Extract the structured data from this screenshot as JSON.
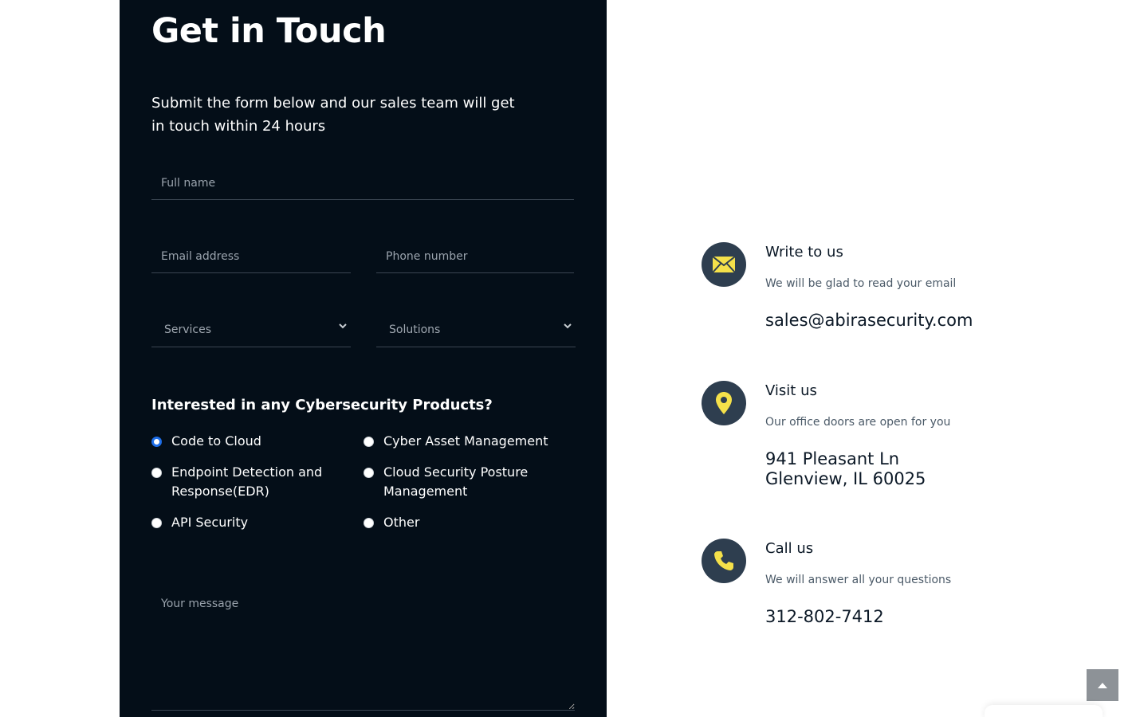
{
  "form": {
    "title": "Get in Touch",
    "subtitle": "Submit the form below and our sales team will get in touch within 24 hours",
    "full_name_placeholder": "Full name",
    "email_placeholder": "Email address",
    "phone_placeholder": "Phone number",
    "services_select": "Services",
    "solutions_select": "Solutions",
    "products_heading": "Interested in any Cybersecurity Products?",
    "products": [
      {
        "label": "Code to Cloud",
        "checked": true
      },
      {
        "label": "Cyber Asset Management",
        "checked": false
      },
      {
        "label": "Endpoint Detection and Response(EDR)",
        "checked": false
      },
      {
        "label": "Cloud Security Posture Management",
        "checked": false
      },
      {
        "label": "API Security",
        "checked": false
      },
      {
        "label": "Other",
        "checked": false
      }
    ],
    "message_placeholder": "Your message"
  },
  "contacts": {
    "write": {
      "title": "Write to us",
      "subtitle": "We will be glad to read your email",
      "value": "sales@abirasecurity.com",
      "icon": "envelope-icon"
    },
    "visit": {
      "title": "Visit us",
      "subtitle": "Our office doors are open for you",
      "address_line1": "941 Pleasant Ln",
      "address_line2": "Glenview, IL 60025",
      "icon": "map-pin-icon"
    },
    "call": {
      "title": "Call us",
      "subtitle": "We will answer all your questions",
      "value": "312-802-7412",
      "icon": "phone-icon"
    }
  },
  "colors": {
    "panel_bg": "#040e18",
    "icon_circle": "#2e3e4f",
    "icon_accent": "#f5e14a",
    "radio_checked": "#1e6ee8"
  }
}
